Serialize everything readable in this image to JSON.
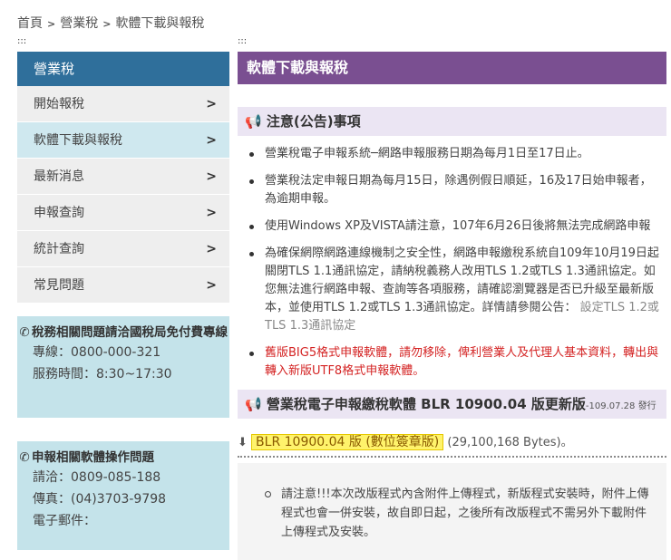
{
  "breadcrumb": [
    "首頁",
    "營業稅",
    "軟體下載與報稅"
  ],
  "dots": ":::",
  "sidebar": {
    "header": "營業稅",
    "items": [
      {
        "label": "開始報稅",
        "active": false
      },
      {
        "label": "軟體下載與報稅",
        "active": true
      },
      {
        "label": "最新消息",
        "active": false
      },
      {
        "label": "申報查詢",
        "active": false
      },
      {
        "label": "統計查詢",
        "active": false
      },
      {
        "label": "常見問題",
        "active": false
      }
    ],
    "info_boxes": [
      {
        "title": "稅務相關問題請洽國稅局免付費專線",
        "lines": [
          "專線：0800-000-321",
          "服務時間：8:30~17:30"
        ]
      },
      {
        "title": "申報相關軟體操作問題",
        "lines": [
          "請洽：0809-085-188",
          "傳真：(04)3703-9798",
          "電子郵件："
        ]
      }
    ]
  },
  "main": {
    "title": "軟體下載與報稅",
    "notice_heading": "注意(公告)事項",
    "notes": [
      "營業稅電子申報系統─網路申報服務日期為每月1日至17日止。",
      "營業稅法定申報日期為每月15日，除遇例假日順延，16及17日始申報者，為逾期申報。",
      "使用Windows XP及VISTA請注意，107年6月26日後將無法完成網路申報",
      "為確保網際網路連線機制之安全性，網路申報繳稅系統自109年10月19日起關閉TLS 1.1通訊協定，請納稅義務人改用TLS 1.2或TLS 1.3通訊協定。如您無法進行網路申報、查詢等各項服務，請確認瀏覽器是否已升級至最新版本，並使用TLS 1.2或TLS 1.3通訊協定。詳情請參閱公告：",
      "舊版BIG5格式申報軟體，請勿移除，俾利營業人及代理人基本資料，轉出與轉入新版UTF8格式申報軟體。"
    ],
    "note_link": "設定TLS 1.2或TLS 1.3通訊協定",
    "software_heading": "營業稅電子申報繳稅軟體 BLR 10900.04 版更新版",
    "software_date": "-109.07.28 發行",
    "download_label": "BLR 10900.04 版 (數位簽章版)",
    "download_size": "(29,100,168 Bytes)。",
    "install_note": "請注意!!!本次改版程式內含附件上傳程式，新版程式安裝時，附件上傳程式也會一併安裝，故自即日起，之後所有改版程式不需另外下載附件上傳程式及安裝。"
  }
}
